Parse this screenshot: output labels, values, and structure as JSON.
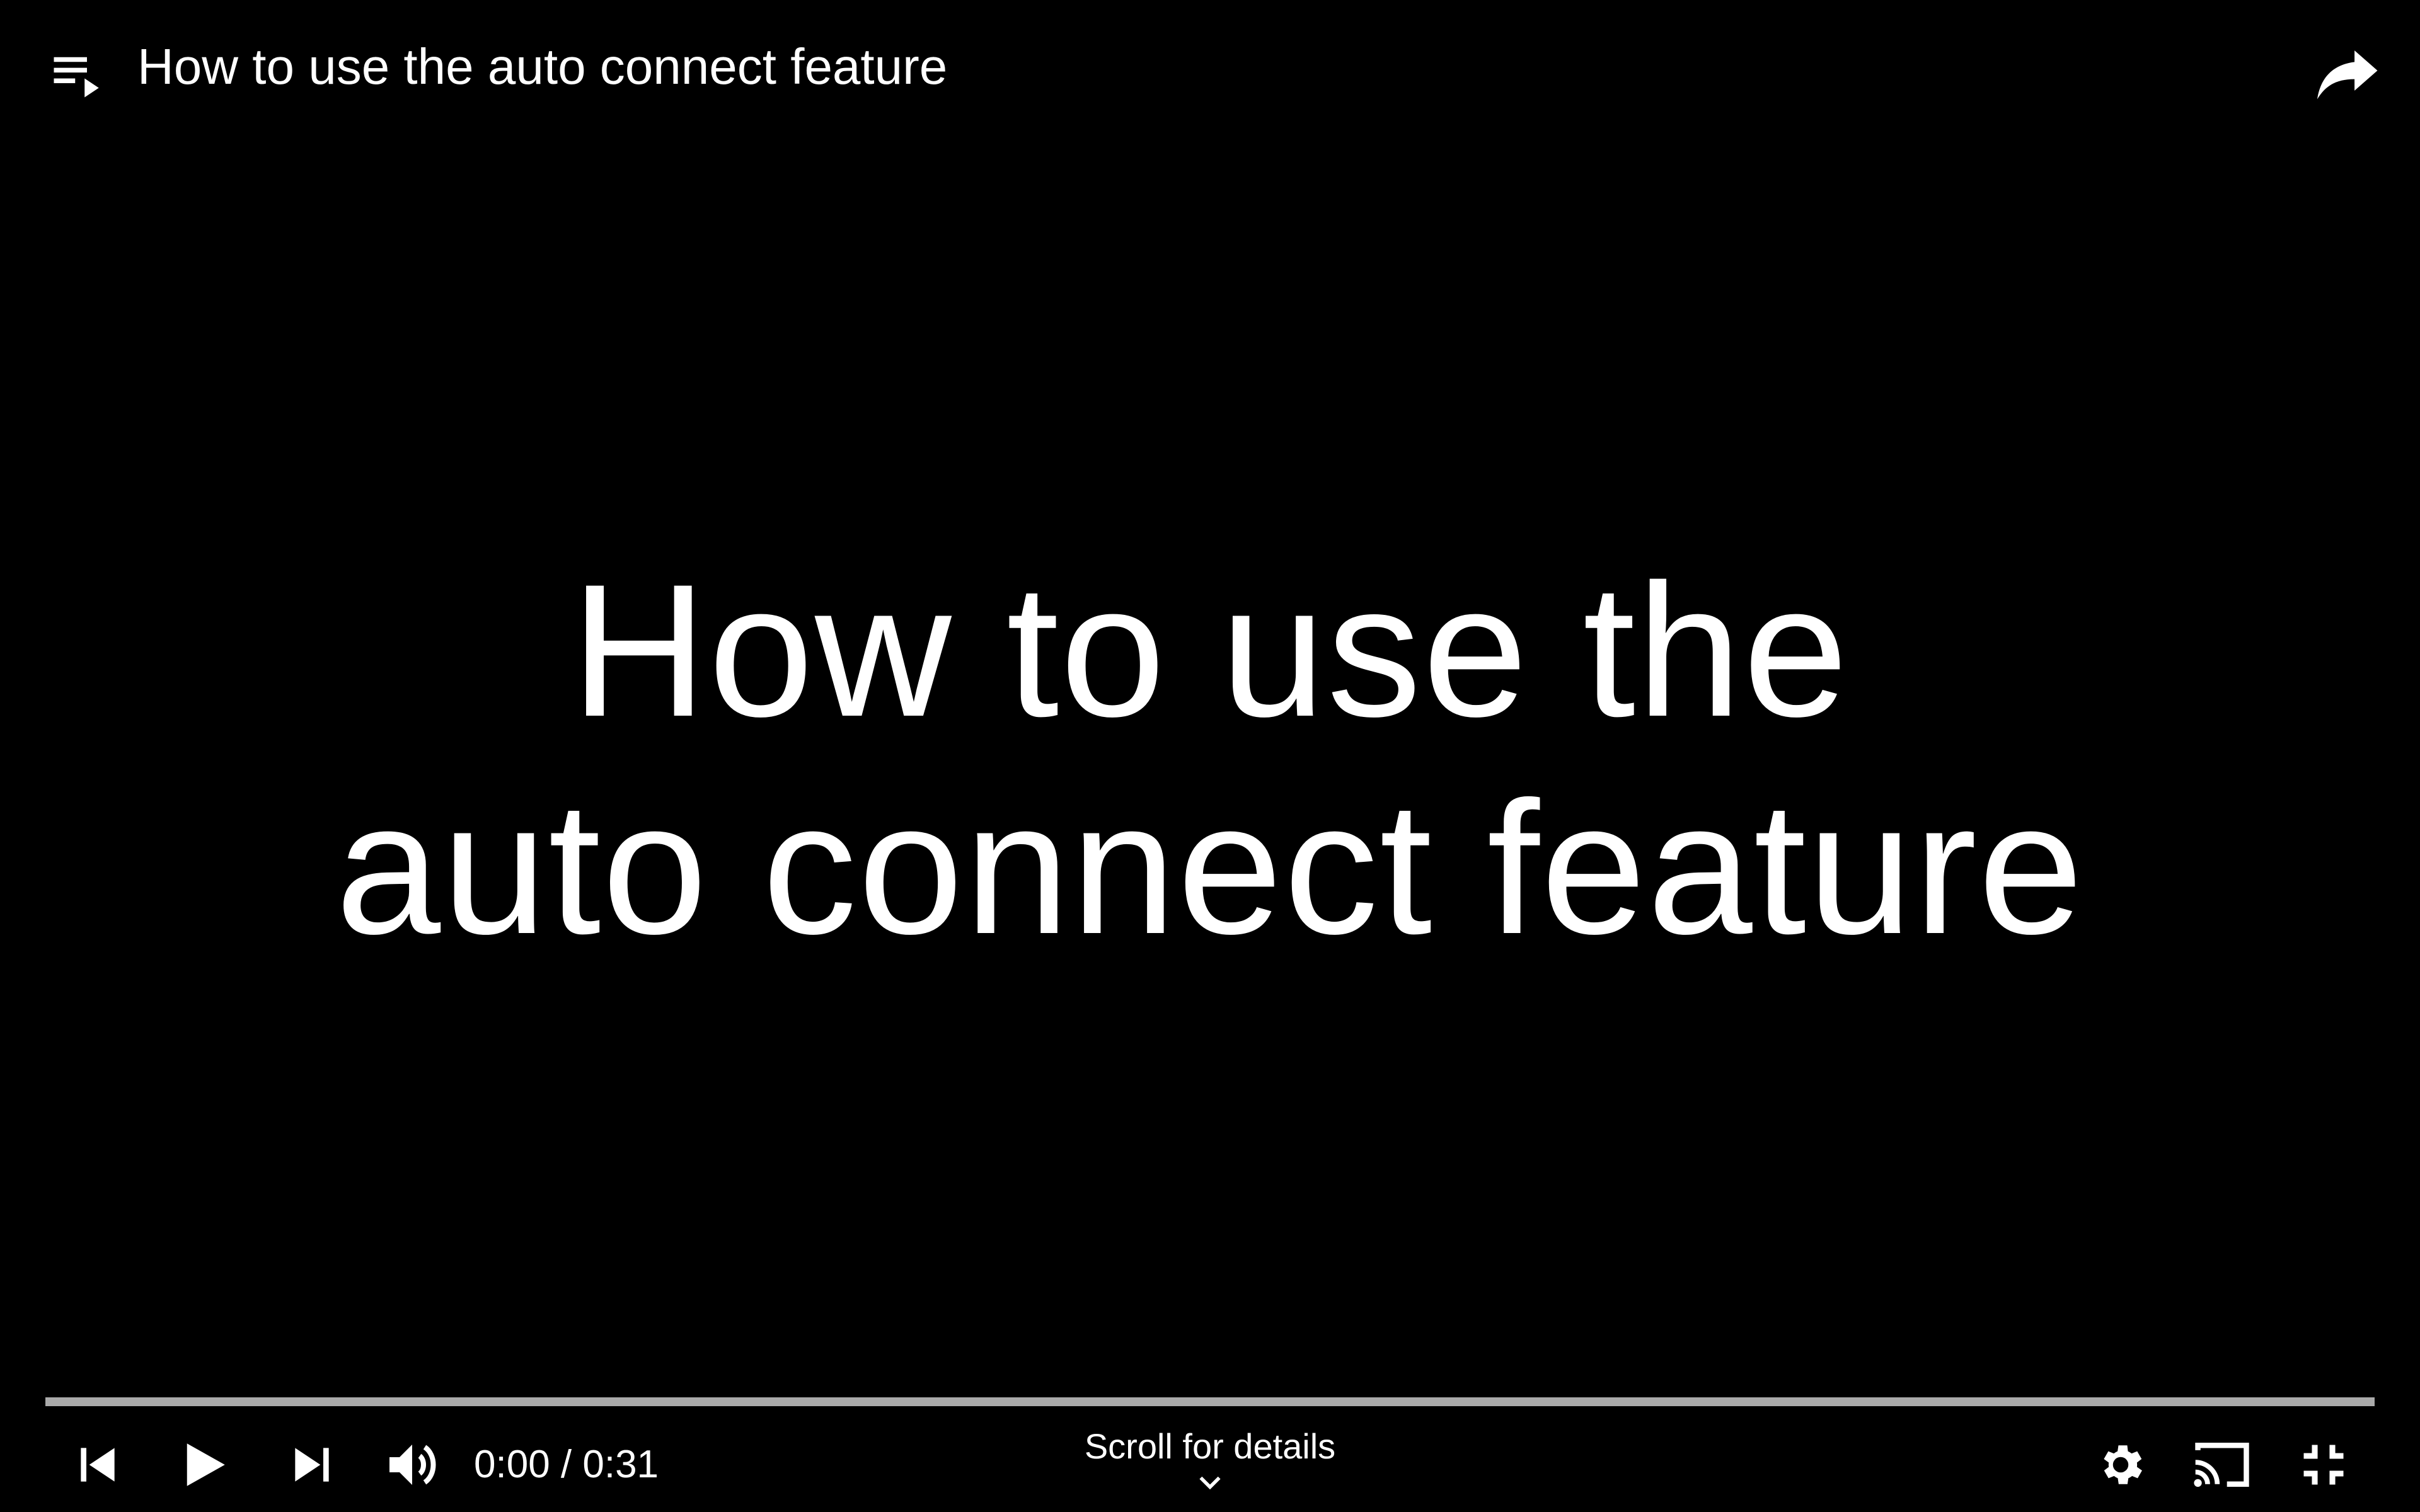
{
  "header": {
    "title": "How to use the auto connect feature",
    "playlist_icon": "playlist-play-icon",
    "share_icon": "share-arrow-icon"
  },
  "video_frame": {
    "line1": "How to use the",
    "line2": "auto connect feature"
  },
  "controls": {
    "current_time": "0:00",
    "separator": " / ",
    "duration": "0:31",
    "scroll_hint": "Scroll for details",
    "progress_fraction": 0.0,
    "icons": {
      "previous": "skip-previous-icon",
      "play": "play-icon",
      "next": "skip-next-icon",
      "volume": "volume-up-icon",
      "settings": "gear-icon",
      "cast": "cast-icon",
      "fullscreen_exit": "fullscreen-exit-icon",
      "scroll": "chevron-down-icon"
    }
  },
  "colors": {
    "background": "#000000",
    "text": "#ffffff",
    "progress_track": "#c8c8c8",
    "progress_played": "#ff0000"
  }
}
